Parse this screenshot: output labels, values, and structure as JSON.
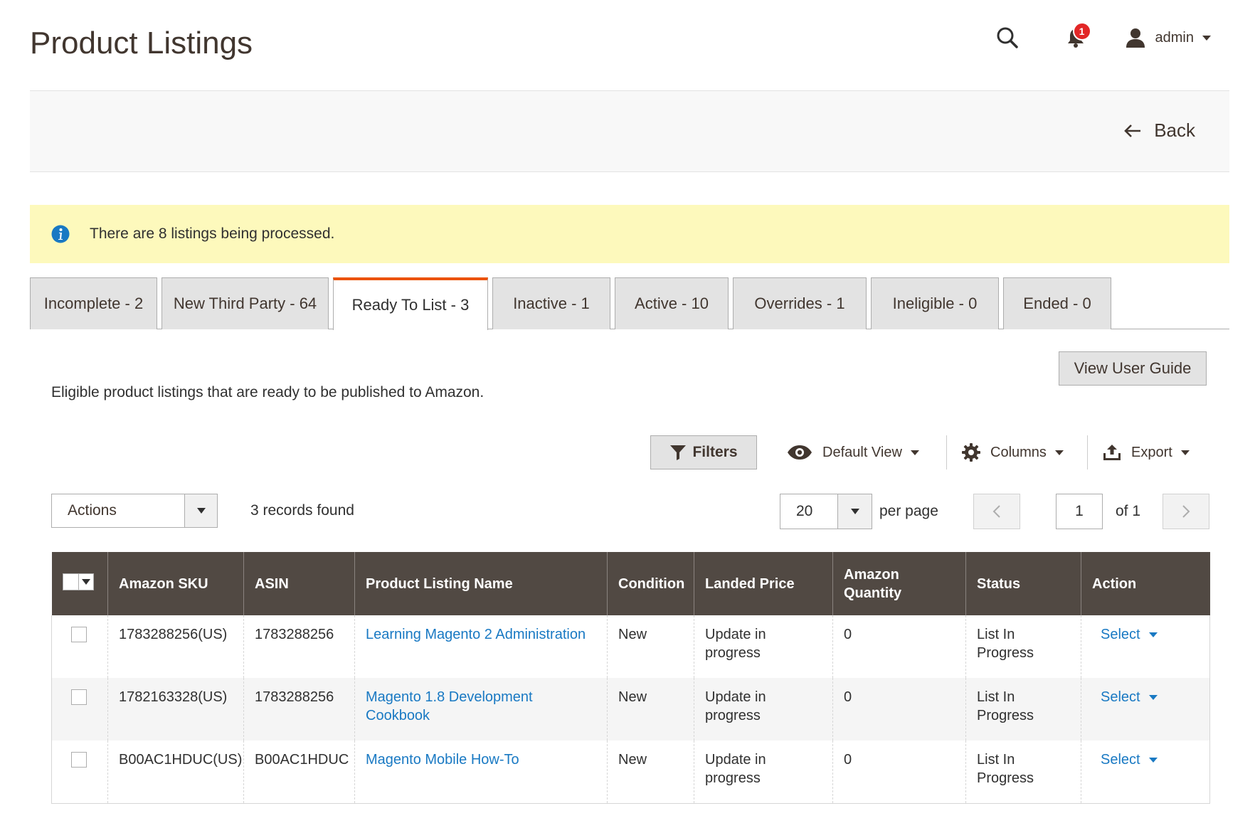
{
  "header": {
    "title": "Product Listings",
    "notification_count": "1",
    "user_name": "admin"
  },
  "page_actions": {
    "back_label": "Back"
  },
  "message": {
    "text": "There are 8 listings being processed."
  },
  "tabs": [
    {
      "label": "Incomplete - 2",
      "active": false
    },
    {
      "label": "New Third Party - 64",
      "active": false
    },
    {
      "label": "Ready To List - 3",
      "active": true
    },
    {
      "label": "Inactive - 1",
      "active": false
    },
    {
      "label": "Active - 10",
      "active": false
    },
    {
      "label": "Overrides - 1",
      "active": false
    },
    {
      "label": "Ineligible - 0",
      "active": false
    },
    {
      "label": "Ended - 0",
      "active": false
    }
  ],
  "tab_content": {
    "description": "Eligible product listings that are ready to be published to Amazon.",
    "view_user_guide_label": "View User Guide"
  },
  "toolbar": {
    "filters_label": "Filters",
    "view_label": "Default View",
    "columns_label": "Columns",
    "export_label": "Export"
  },
  "grid_controls": {
    "actions_label": "Actions",
    "records_found": "3 records found",
    "per_page_value": "20",
    "per_page_label": "per page",
    "current_page": "1",
    "page_of": "of 1"
  },
  "grid": {
    "columns": [
      "Amazon SKU",
      "ASIN",
      "Product Listing Name",
      "Condition",
      "Landed Price",
      "Amazon Quantity",
      "Status",
      "Action"
    ],
    "rows": [
      {
        "sku": "1783288256(US)",
        "asin": "1783288256",
        "name": "Learning Magento 2 Administration",
        "condition": "New",
        "landed_price": "Update in progress",
        "quantity": "0",
        "status": "List In Progress",
        "action": "Select"
      },
      {
        "sku": "1782163328(US)",
        "asin": "1783288256",
        "name": "Magento 1.8 Development Cookbook",
        "condition": "New",
        "landed_price": "Update in progress",
        "quantity": "0",
        "status": "List In Progress",
        "action": "Select"
      },
      {
        "sku": "B00AC1HDUC(US)",
        "asin": "B00AC1HDUC",
        "name": "Magento Mobile How-To",
        "condition": "New",
        "landed_price": "Update in progress",
        "quantity": "0",
        "status": "List In Progress",
        "action": "Select"
      }
    ]
  },
  "colors": {
    "header_bg": "#514943",
    "accent": "#eb5202",
    "link": "#1979c3",
    "message_bg": "#fdf9bc",
    "badge": "#e22626"
  },
  "icons": {
    "search": "search-icon",
    "notifications": "bell-icon",
    "user": "user-icon",
    "back": "arrow-left-icon",
    "info": "info-icon",
    "filters": "filter-icon",
    "view": "eye-icon",
    "columns": "gear-icon",
    "export": "export-icon"
  }
}
